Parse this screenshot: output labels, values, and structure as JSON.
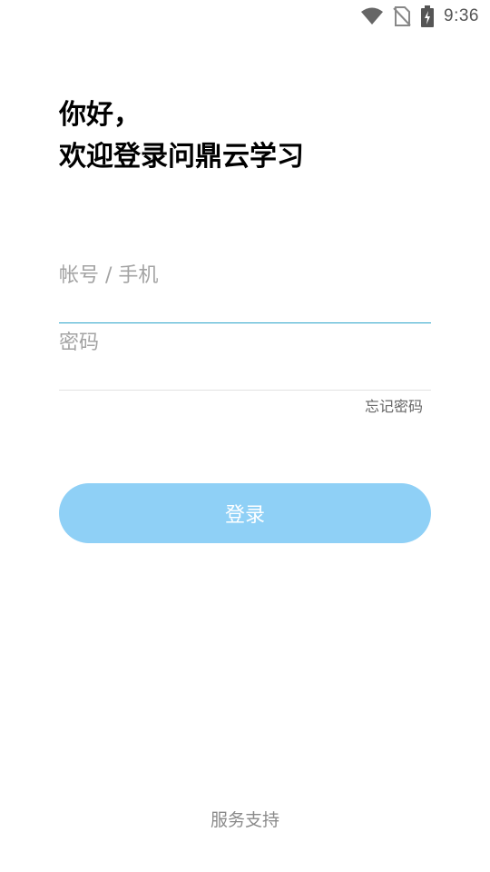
{
  "status_bar": {
    "time": "9:36",
    "icons": [
      "wifi-icon",
      "no-sim-icon",
      "battery-charging-icon"
    ]
  },
  "greeting": {
    "line1": "你好，",
    "line2": "欢迎登录问鼎云学习"
  },
  "form": {
    "account_placeholder": "帐号 / 手机",
    "account_value": "",
    "password_placeholder": "密码",
    "password_value": "",
    "forgot_password": "忘记密码",
    "login_button": "登录"
  },
  "footer": {
    "support": "服务支持"
  },
  "colors": {
    "accent_underline": "#2aa3c9",
    "button_background": "#8fd0f6",
    "placeholder": "#a3a3a3"
  }
}
